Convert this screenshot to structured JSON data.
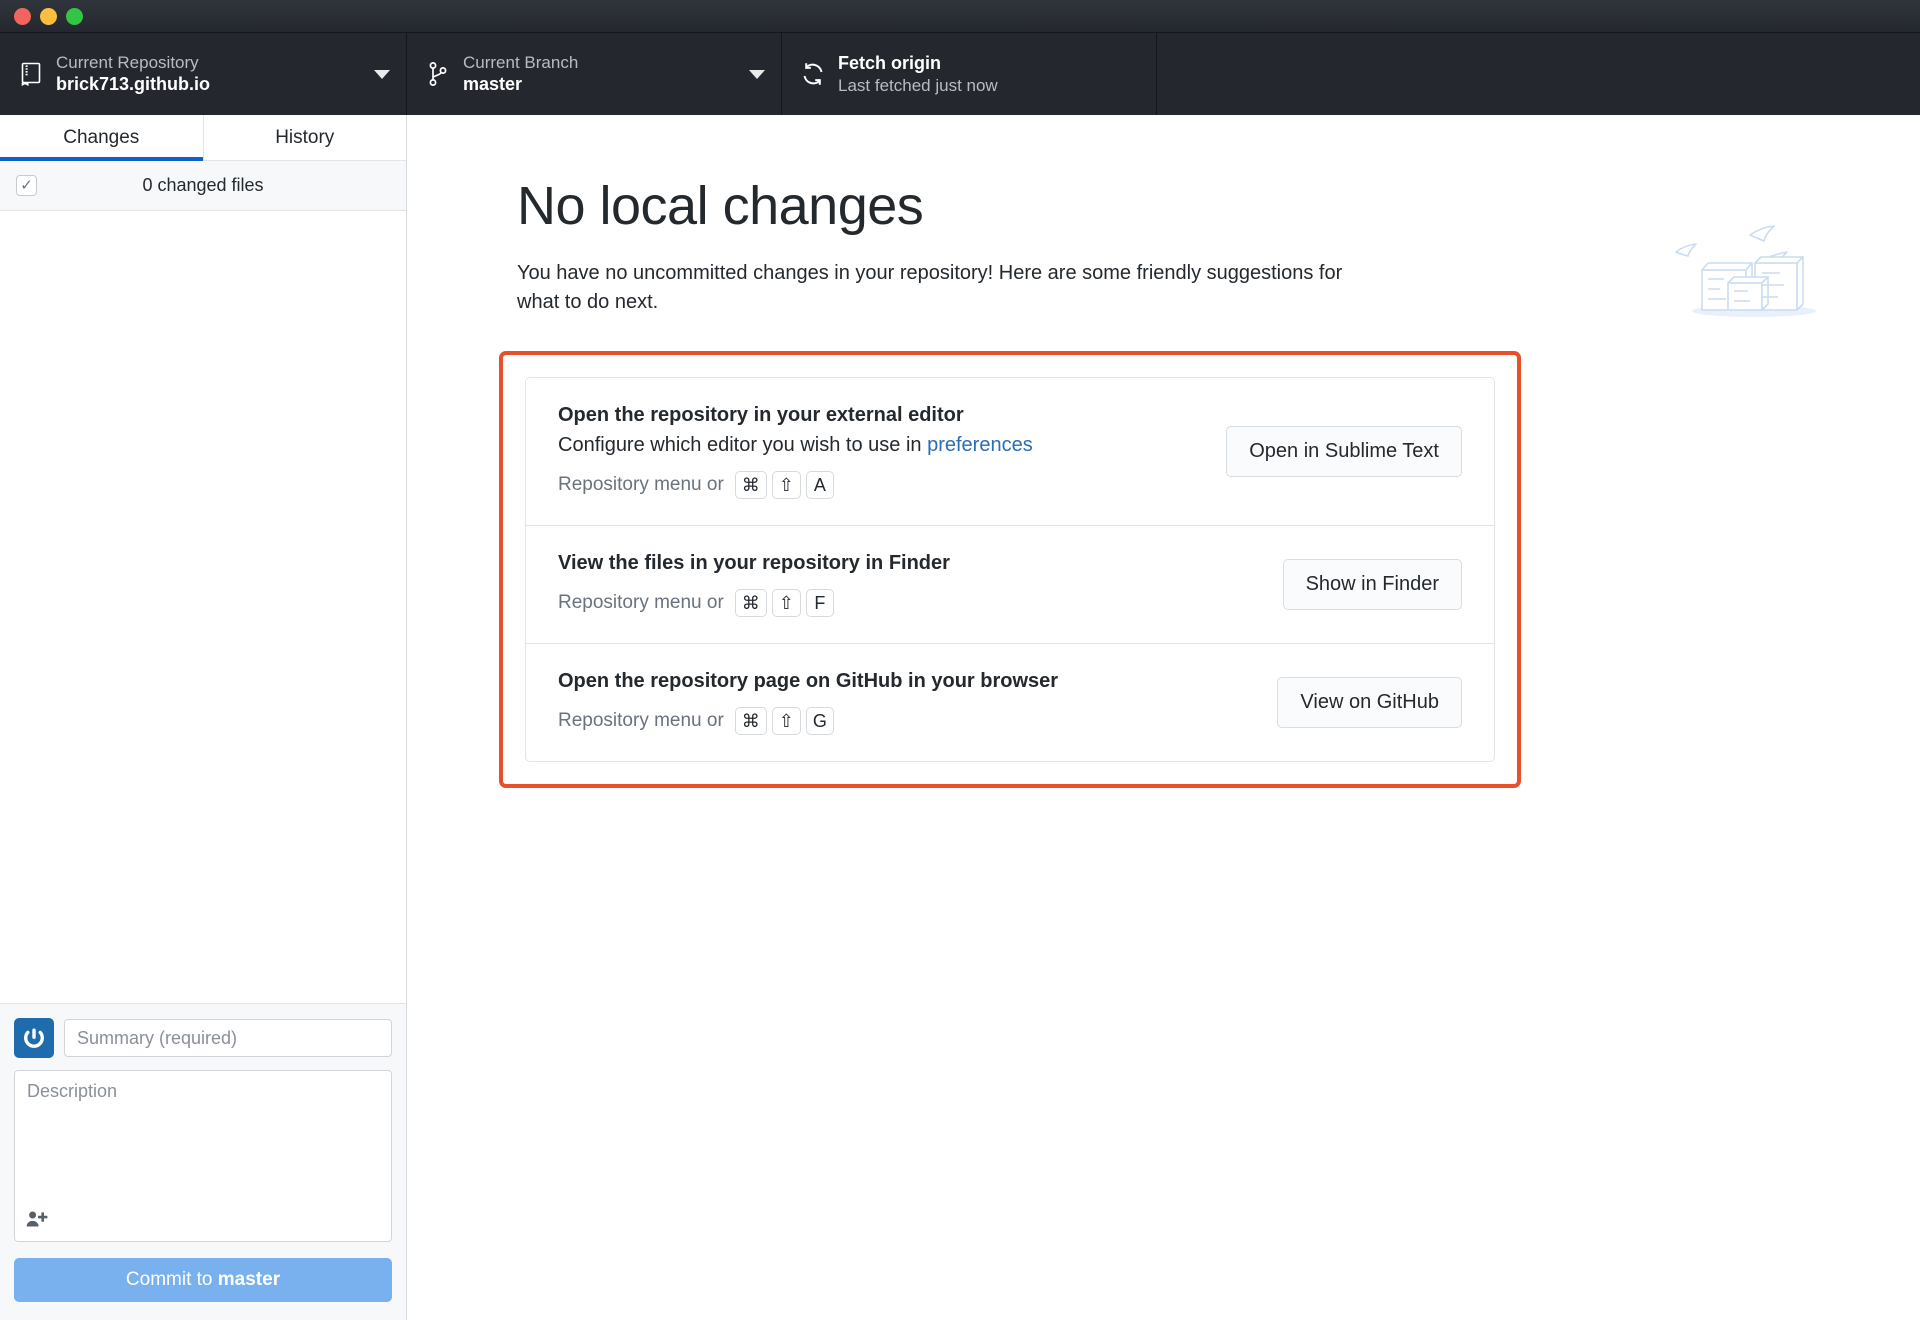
{
  "window": {
    "traffic_lights": [
      "close-red",
      "minimize-yellow",
      "maximize-green"
    ]
  },
  "toolbar": {
    "repository": {
      "label": "Current Repository",
      "value": "brick713.github.io",
      "icon": "repo-book-icon",
      "caret": "chevron-down-icon"
    },
    "branch": {
      "label": "Current Branch",
      "value": "master",
      "icon": "git-branch-icon",
      "caret": "chevron-down-icon"
    },
    "fetch": {
      "title": "Fetch origin",
      "subtitle": "Last fetched just now",
      "icon": "sync-refresh-icon"
    }
  },
  "sidebar": {
    "tabs": [
      {
        "label": "Changes",
        "active": true
      },
      {
        "label": "History",
        "active": false
      }
    ],
    "files_header": {
      "count_label": "0 changed files",
      "checkbox_state": "checked",
      "checkbox_glyph": "✓"
    },
    "commit_form": {
      "avatar_icon": "user-avatar-identicon",
      "summary_placeholder": "Summary (required)",
      "summary_value": "",
      "description_placeholder": "Description",
      "description_value": "",
      "coauthor_icon": "add-person-icon",
      "commit_button_prefix": "Commit to ",
      "commit_button_branch": "master"
    }
  },
  "main": {
    "title": "No local changes",
    "blurb": "You have no uncommitted changes in your repository! Here are some friendly suggestions for what to do next.",
    "illustration": "boxes-and-paper-planes-illustration",
    "highlight_color": "#e8502a",
    "link_color": "#2b6cb7",
    "suggestions": [
      {
        "title": "Open the repository in your external editor",
        "description_prefix": "Configure which editor you wish to use in ",
        "description_link": "preferences",
        "shortcut_label": "Repository menu or",
        "keys": [
          "⌘",
          "⇧",
          "A"
        ],
        "button": "Open in Sublime Text"
      },
      {
        "title": "View the files in your repository in Finder",
        "description_prefix": "",
        "description_link": "",
        "shortcut_label": "Repository menu or",
        "keys": [
          "⌘",
          "⇧",
          "F"
        ],
        "button": "Show in Finder"
      },
      {
        "title": "Open the repository page on GitHub in your browser",
        "description_prefix": "",
        "description_link": "",
        "shortcut_label": "Repository menu or",
        "keys": [
          "⌘",
          "⇧",
          "G"
        ],
        "button": "View on GitHub"
      }
    ]
  },
  "colors": {
    "titlebar": "#24282e",
    "accent_blue": "#1160c9",
    "commit_button": "#79b0ee",
    "highlight_orange": "#e8502a"
  }
}
